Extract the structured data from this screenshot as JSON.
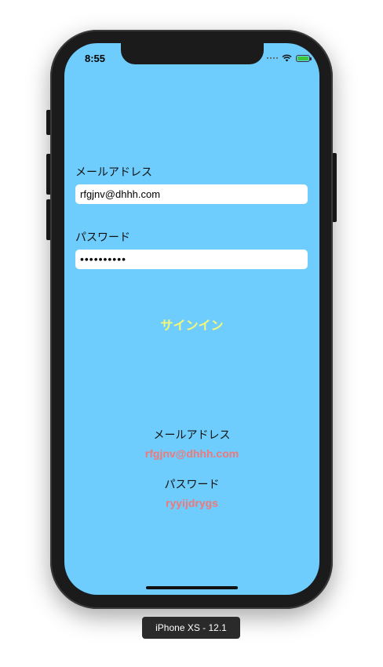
{
  "status_bar": {
    "time": "8:55",
    "wifi_icon": "wifi-icon",
    "battery_icon": "battery-charging-icon"
  },
  "form": {
    "email_label": "メールアドレス",
    "email_value": "rfgjnv@dhhh.com",
    "password_label": "パスワード",
    "password_value": "••••••••••",
    "signin_label": "サインイン"
  },
  "result": {
    "email_label": "メールアドレス",
    "email_value": "rfgjnv@dhhh.com",
    "password_label": "パスワード",
    "password_value": "ryyijdrygs"
  },
  "simulator": {
    "device_caption": "iPhone XS - 12.1"
  },
  "colors": {
    "screen_background": "#6ecdfd",
    "signin_text": "#f5f777",
    "result_value_text": "#f07878"
  }
}
